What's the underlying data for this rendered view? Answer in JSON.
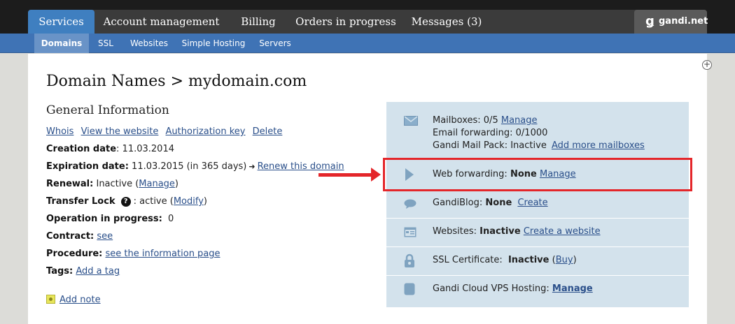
{
  "nav": {
    "tabs": [
      {
        "label": "Services",
        "active": true
      },
      {
        "label": "Account management"
      },
      {
        "label": "Billing"
      },
      {
        "label": "Orders in progress"
      },
      {
        "label": "Messages (3)"
      }
    ],
    "brand": "gandi.net"
  },
  "subnav": {
    "tabs": [
      {
        "label": "Domains",
        "active": true
      },
      {
        "label": "SSL"
      },
      {
        "label": "Websites"
      },
      {
        "label": "Simple Hosting"
      },
      {
        "label": "Servers"
      }
    ]
  },
  "page": {
    "title": "Domain Names > mydomain.com",
    "section_title": "General Information"
  },
  "general": {
    "links": [
      "Whois",
      "View the website",
      "Authorization key",
      "Delete"
    ],
    "creation_label": "Creation date",
    "creation_value": ": 11.03.2014",
    "expiration_label": "Expiration date:",
    "expiration_value": "11.03.2015 (in 365 days)",
    "renew_link": "Renew this domain",
    "renewal_label": "Renewal:",
    "renewal_value": "Inactive (",
    "renewal_link": "Manage",
    "renewal_close": ")",
    "transfer_label": "Transfer Lock",
    "transfer_value": ": active (",
    "transfer_link": "Modify",
    "transfer_close": ")",
    "operation_label": "Operation in progress:",
    "operation_value": "0",
    "contract_label": "Contract:",
    "contract_link": "see",
    "procedure_label": "Procedure:",
    "procedure_link": "see the information page",
    "tags_label": "Tags:",
    "tags_link": "Add a tag",
    "add_note": "Add note"
  },
  "services": {
    "mailbox_line1_prefix": "Mailboxes: 0/5",
    "mailbox_manage": "Manage",
    "mailbox_line2": "Email forwarding: 0/1000",
    "mailbox_line3_prefix": "Gandi Mail Pack: Inactive",
    "mailbox_add": "Add more mailboxes",
    "webfwd_label": "Web forwarding:",
    "webfwd_value": "None",
    "webfwd_link": "Manage",
    "blog_label": "GandiBlog:",
    "blog_value": "None",
    "blog_link": "Create",
    "websites_label": "Websites:",
    "websites_value": "Inactive",
    "websites_link": "Create a website",
    "ssl_label": "SSL Certificate:",
    "ssl_value": "Inactive",
    "ssl_open": "(",
    "ssl_link": "Buy",
    "ssl_close": ")",
    "vps_label": "Gandi Cloud VPS Hosting:",
    "vps_link": "Manage"
  },
  "colors": {
    "annotation": "#e4262a",
    "active_tab": "#3f7fc0",
    "side_panel": "#d3e2ec"
  }
}
